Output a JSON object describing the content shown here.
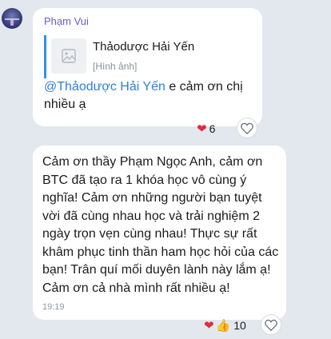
{
  "message1": {
    "sender": "Phạm Vui",
    "reply": {
      "title": "Thảodược Hải Yến",
      "subtitle": "[Hình ảnh]"
    },
    "mention": "@Thảodược Hải Yến",
    "text": " e cảm ơn chị nhiều ạ",
    "reactions": {
      "icon": "heart-icon",
      "count": "6"
    }
  },
  "message2": {
    "text": "Cảm ơn thầy Phạm Ngọc Anh, cảm ơn BTC đã tạo ra 1 khóa học vô cùng ý nghĩa! Cảm ơn những người bạn tuyệt vời đã cùng nhau học và trải nghiệm 2 ngày trọn vẹn cùng nhau! Thực sự rất khâm phục tinh thần ham học hỏi của các bạn! Trân quí mối duyên lành này lắm ạ! Cảm ơn cả nhà mình rất nhiều ạ!",
    "time": "19:19",
    "reactions": {
      "icons": [
        "heart-icon",
        "thumbs-up-icon"
      ],
      "count": "10"
    }
  },
  "colors": {
    "background": "#e3e8ef",
    "bubble": "#ffffff",
    "sender": "#6a5ad3",
    "link": "#2f7fe0",
    "heart": "#e22b3b"
  }
}
